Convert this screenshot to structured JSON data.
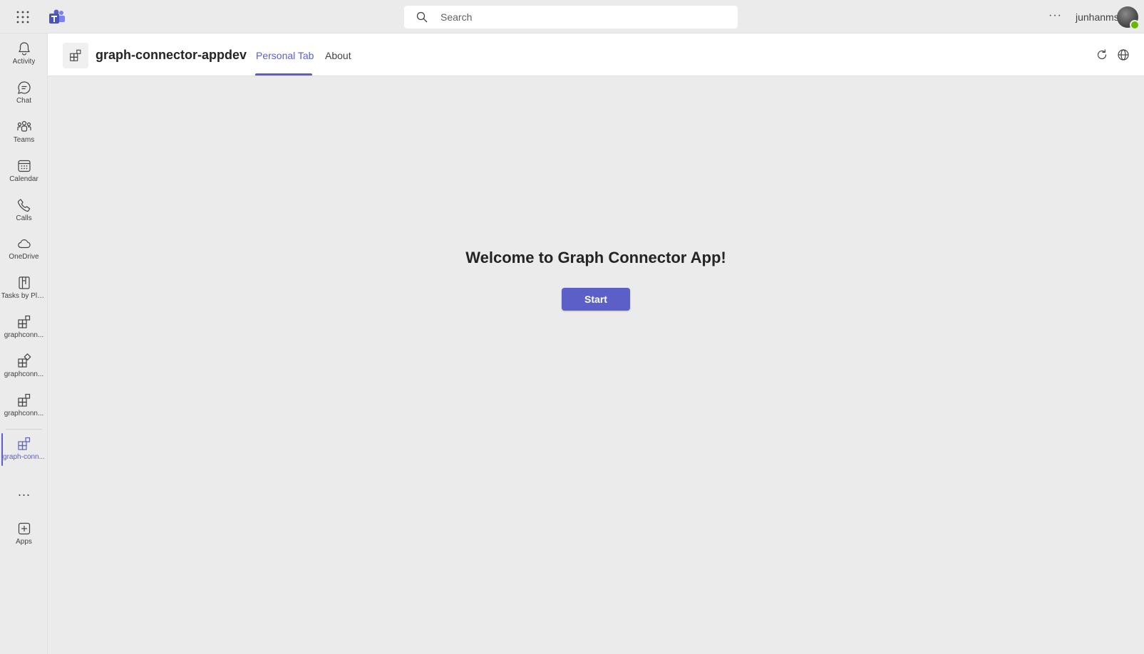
{
  "titlebar": {
    "search_placeholder": "Search",
    "more_label": "···",
    "username": "junhanms",
    "presence": "available"
  },
  "rail": {
    "items": [
      {
        "label": "Activity",
        "icon": "bell-icon"
      },
      {
        "label": "Chat",
        "icon": "chat-icon"
      },
      {
        "label": "Teams",
        "icon": "teams-icon"
      },
      {
        "label": "Calendar",
        "icon": "calendar-icon"
      },
      {
        "label": "Calls",
        "icon": "phone-icon"
      },
      {
        "label": "OneDrive",
        "icon": "cloud-icon"
      },
      {
        "label": "Tasks by Pla...",
        "icon": "tasks-icon"
      },
      {
        "label": "graphconn...",
        "icon": "app-grid-icon"
      },
      {
        "label": "graphconn...",
        "icon": "app-grid-icon"
      },
      {
        "label": "graphconn...",
        "icon": "app-grid-icon"
      },
      {
        "label": "graph-conn...",
        "icon": "app-grid-icon",
        "active": true
      }
    ],
    "more_label": "···",
    "apps_label": "Apps"
  },
  "app": {
    "title": "graph-connector-appdev",
    "tabs": [
      {
        "label": "Personal Tab",
        "active": true
      },
      {
        "label": "About",
        "active": false
      }
    ]
  },
  "main": {
    "welcome": "Welcome to Graph Connector App!",
    "start_label": "Start"
  },
  "colors": {
    "accent": "#5b5fc7",
    "background": "#ebebeb",
    "header": "#ffffff"
  }
}
